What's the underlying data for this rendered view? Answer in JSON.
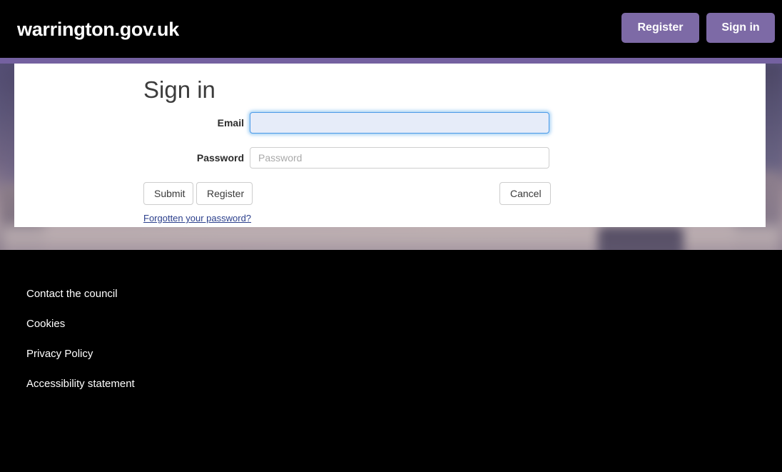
{
  "header": {
    "site_title": "warrington.gov.uk",
    "register_label": "Register",
    "signin_label": "Sign in",
    "background_color": "#000000",
    "button_color": "#7d6aa6",
    "accent_bar_color": "#7461a0"
  },
  "main": {
    "page_title": "Sign in",
    "fields": [
      {
        "label": "Email",
        "value": "",
        "placeholder": "",
        "focused": true
      },
      {
        "label": "Password",
        "value": "",
        "placeholder": "Password",
        "focused": false
      }
    ],
    "buttons": {
      "submit_label": "Submit",
      "register_label": "Register",
      "cancel_label": "Cancel"
    },
    "forgot_password_label": "Forgotten your password?",
    "link_color": "#2b3f8c"
  },
  "footer": {
    "links": [
      {
        "label": "Contact the council"
      },
      {
        "label": "Cookies"
      },
      {
        "label": "Privacy Policy"
      },
      {
        "label": "Accessibility statement"
      }
    ],
    "background_color": "#000000"
  }
}
